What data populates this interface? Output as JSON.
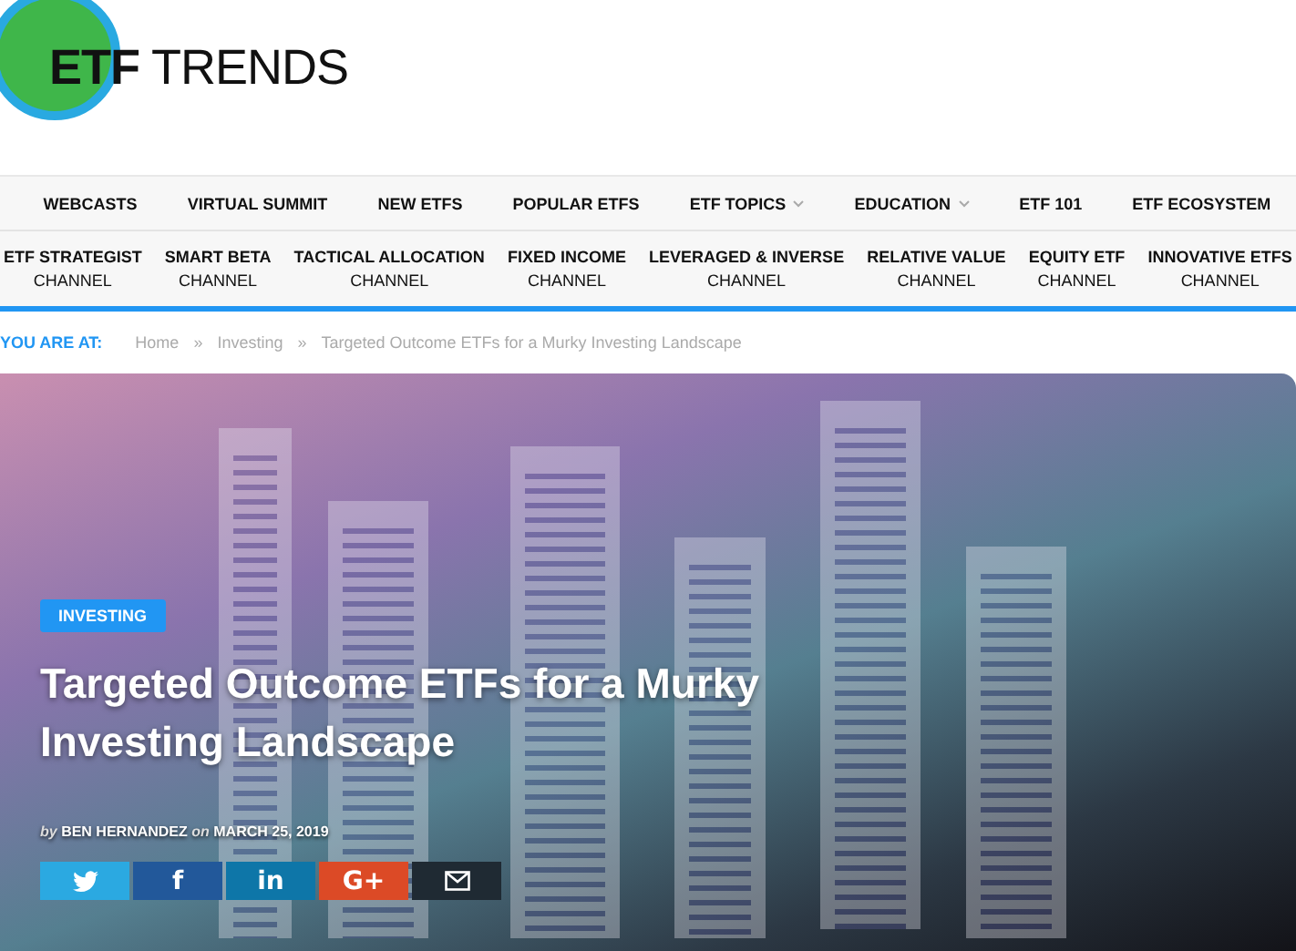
{
  "logo": {
    "bold": "ETF",
    "regular": "TRENDS"
  },
  "nav_primary": [
    {
      "label": "WEBCASTS",
      "dropdown": false
    },
    {
      "label": "VIRTUAL SUMMIT",
      "dropdown": false
    },
    {
      "label": "NEW ETFS",
      "dropdown": false
    },
    {
      "label": "POPULAR ETFS",
      "dropdown": false
    },
    {
      "label": "ETF TOPICS",
      "dropdown": true
    },
    {
      "label": "EDUCATION",
      "dropdown": true
    },
    {
      "label": "ETF 101",
      "dropdown": false
    },
    {
      "label": "ETF ECOSYSTEM",
      "dropdown": false
    }
  ],
  "nav_channels": [
    {
      "name": "ETF STRATEGIST",
      "sub": "CHANNEL"
    },
    {
      "name": "SMART BETA",
      "sub": "CHANNEL"
    },
    {
      "name": "TACTICAL ALLOCATION",
      "sub": "CHANNEL"
    },
    {
      "name": "FIXED INCOME",
      "sub": "CHANNEL"
    },
    {
      "name": "LEVERAGED & INVERSE",
      "sub": "CHANNEL"
    },
    {
      "name": "RELATIVE VALUE",
      "sub": "CHANNEL"
    },
    {
      "name": "EQUITY ETF",
      "sub": "CHANNEL"
    },
    {
      "name": "INNOVATIVE ETFS",
      "sub": "CHANNEL"
    }
  ],
  "breadcrumb": {
    "label": "YOU ARE AT:",
    "separator": "»",
    "items": [
      "Home",
      "Investing",
      "Targeted Outcome ETFs for a Murky Investing Landscape"
    ]
  },
  "article": {
    "category": "INVESTING",
    "title": "Targeted Outcome ETFs for a Murky Investing Landscape",
    "by": "by",
    "author": "BEN HERNANDEZ",
    "on": "on",
    "date": "MARCH 25, 2019",
    "share": [
      {
        "kind": "twitter",
        "color": "#2ba9e1"
      },
      {
        "kind": "facebook",
        "label": "f",
        "color": "#22589a"
      },
      {
        "kind": "linkedin",
        "label": "in",
        "color": "#0e76a8"
      },
      {
        "kind": "googleplus",
        "label": "G+",
        "color": "#dc4a26"
      },
      {
        "kind": "email",
        "color": "#1f2a33"
      }
    ]
  }
}
